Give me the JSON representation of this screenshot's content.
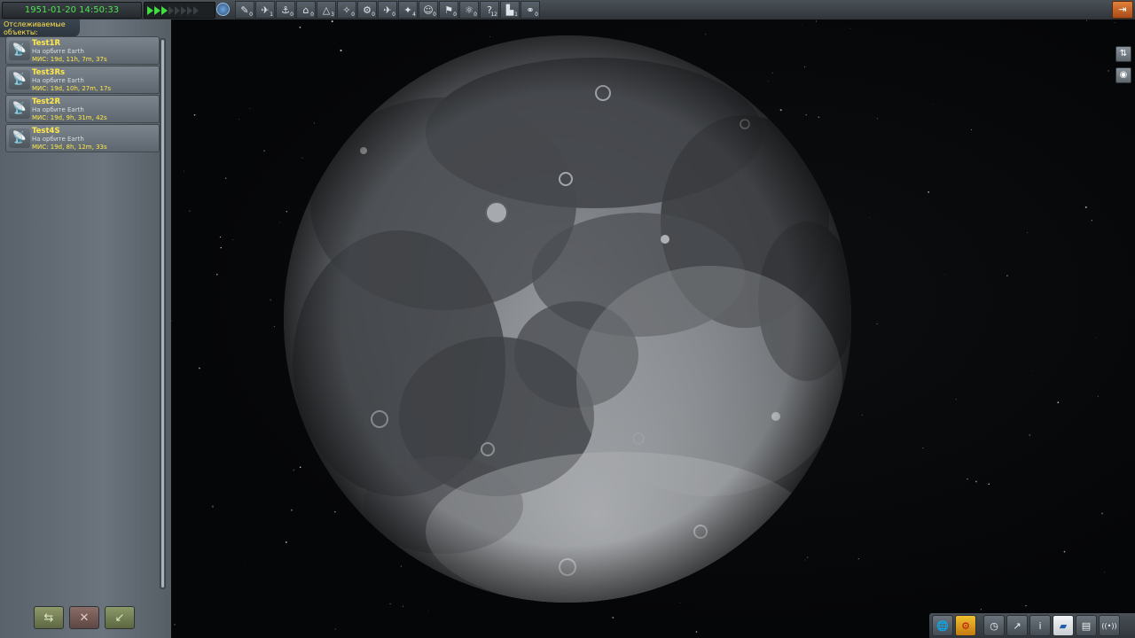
{
  "topbar": {
    "clock": "1951-01-20 14:50:33",
    "warp_level": 3,
    "warp_total": 8,
    "filters": [
      {
        "icon": "debris-icon",
        "glyph": "✎",
        "count": "0"
      },
      {
        "icon": "plane-icon",
        "glyph": "✈",
        "count": "1"
      },
      {
        "icon": "ship-icon",
        "glyph": "⚓",
        "count": "0"
      },
      {
        "icon": "station-icon",
        "glyph": "⌂",
        "count": "0"
      },
      {
        "icon": "lander-icon",
        "glyph": "△",
        "count": "3"
      },
      {
        "icon": "probe-icon",
        "glyph": "✧",
        "count": "0"
      },
      {
        "icon": "rover-icon",
        "glyph": "⚙",
        "count": "0"
      },
      {
        "icon": "aircraft-icon",
        "glyph": "✈",
        "count": "0"
      },
      {
        "icon": "satellite-icon",
        "glyph": "✦",
        "count": "4"
      },
      {
        "icon": "eva-icon",
        "glyph": "☺",
        "count": "0"
      },
      {
        "icon": "flag-icon",
        "glyph": "⚑",
        "count": "0"
      },
      {
        "icon": "deployed-icon",
        "glyph": "⚛",
        "count": "0"
      },
      {
        "icon": "unknown-icon",
        "glyph": "?",
        "count": "12"
      },
      {
        "icon": "base-icon",
        "glyph": "▙",
        "count": "1"
      },
      {
        "icon": "relay-icon",
        "glyph": "⚭",
        "count": "0"
      }
    ]
  },
  "panel": {
    "title": "Отслеживаемые объекты:",
    "vessels": [
      {
        "name": "Test1R",
        "status": "На орбите Earth",
        "met": "МИС: 19d, 11h, 7m, 37s"
      },
      {
        "name": "Test3Rs",
        "status": "На орбите Earth",
        "met": "МИС: 19d, 10h, 27m, 17s"
      },
      {
        "name": "Test2R",
        "status": "На орбите Earth",
        "met": "МИС: 19d, 9h, 31m, 42s"
      },
      {
        "name": "Test4S",
        "status": "На орбите Earth",
        "met": "МИС: 19d, 8h, 12m, 33s"
      }
    ],
    "buttons": {
      "fly": "⇆",
      "delete": "✕",
      "recover": "↙"
    }
  },
  "right_tools": {
    "ui_toggle": "⇅",
    "view": "◉"
  },
  "bottom_bar": [
    {
      "icon": "planets-icon",
      "glyph": "🌐"
    },
    {
      "icon": "toolbar-toggle-icon",
      "glyph": "⚙"
    },
    {
      "icon": "clock-icon",
      "glyph": "◷"
    },
    {
      "icon": "maneuver-icon",
      "glyph": "↗"
    },
    {
      "icon": "info-icon",
      "glyph": "i"
    },
    {
      "icon": "editor-icon",
      "glyph": "▰"
    },
    {
      "icon": "notes-icon",
      "glyph": "▤"
    },
    {
      "icon": "signal-icon",
      "glyph": "((•))"
    }
  ]
}
